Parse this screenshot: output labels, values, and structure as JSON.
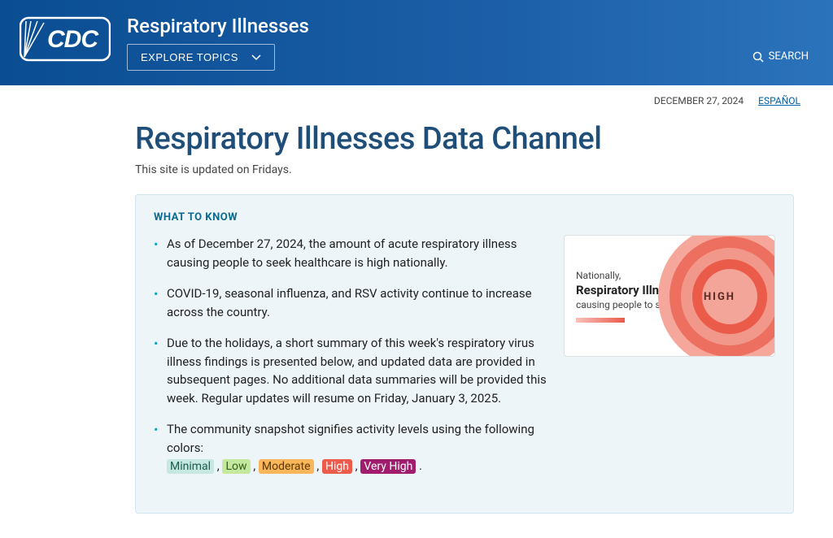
{
  "header": {
    "site_title": "Respiratory Illnesses",
    "explore_label": "EXPLORE TOPICS",
    "search_label": "SEARCH"
  },
  "utility": {
    "date": "DECEMBER 27, 2024",
    "lang_link": "ESPAÑOL"
  },
  "page": {
    "title": "Respiratory Illnesses Data Channel",
    "subtitle": "This site is updated on Fridays."
  },
  "info": {
    "heading": "WHAT TO KNOW",
    "bullets": [
      "As of December 27, 2024, the amount of acute respiratory illness causing people to seek healthcare is high nationally.",
      "COVID-19, seasonal influenza, and RSV activity continue to increase across the country.",
      "Due to the holidays, a short summary of this week's respiratory virus illness findings is presented below, and updated data are provided in subsequent pages. No additional data summaries will be provided this week. Regular updates will resume on Friday, January 3, 2025."
    ],
    "color_intro": "The community snapshot signifies activity levels using the following colors:",
    "levels": {
      "minimal": "Minimal",
      "low": "Low",
      "moderate": "Moderate",
      "high": "High",
      "veryhigh": "Very High"
    }
  },
  "snapshot": {
    "pretext": "Nationally,",
    "title": "Respiratory Illness",
    "subtext": "causing people to seek healthcare is",
    "level": "HIGH"
  }
}
